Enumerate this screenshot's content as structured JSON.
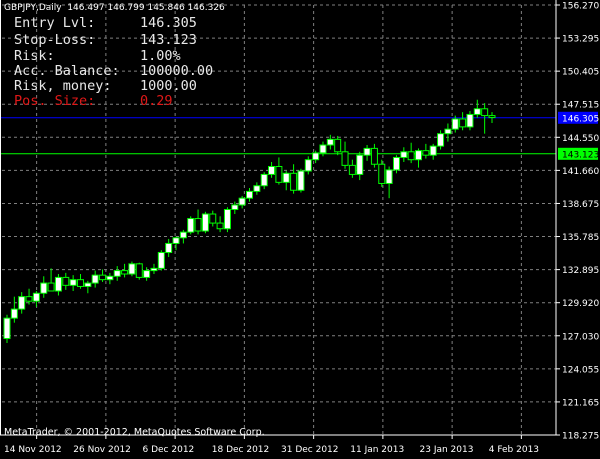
{
  "header": {
    "symbol": "GBPJPY,Daily",
    "ohlc": "146.497 146.799 145.846 146.326"
  },
  "info_panel": [
    {
      "label": "Entry Lvl:",
      "value": "146.305",
      "color": "#e8e8e8"
    },
    {
      "label": "Stop-Loss:",
      "value": "143.123",
      "color": "#e8e8e8"
    },
    {
      "label": "Risk:",
      "value": "1.00%",
      "color": "#e8e8e8"
    },
    {
      "label": "Acc. Balance:",
      "value": "100000.00",
      "color": "#e8e8e8"
    },
    {
      "label": "Risk, money:",
      "value": "1000.00",
      "color": "#e8e8e8"
    },
    {
      "label": "Pos. Size:",
      "value": "0.29",
      "color": "#e01818"
    }
  ],
  "copyright": "MetaTrader, © 2001-2012, MetaQuotes Software Corp.",
  "chart_data": {
    "type": "candlestick",
    "ylim": [
      118.275,
      156.27
    ],
    "y_ticks": [
      "156.270",
      "153.295",
      "150.405",
      "147.515",
      "144.550",
      "141.660",
      "138.675",
      "135.785",
      "132.895",
      "129.920",
      "127.030",
      "124.055",
      "121.165",
      "118.275"
    ],
    "x_ticks": [
      "14 Nov 2012",
      "26 Nov 2012",
      "6 Dec 2012",
      "18 Dec 2012",
      "31 Dec 2012",
      "11 Jan 2013",
      "23 Jan 2013",
      "4 Feb 2013"
    ],
    "levels": [
      {
        "name": "entry",
        "value": 146.305,
        "label": "146.305",
        "color": "#0000ff",
        "label_bg": "#0000ff",
        "label_color": "#ffffff"
      },
      {
        "name": "stop-loss",
        "value": 143.123,
        "label": "143.123",
        "color": "#00ff00",
        "label_bg": "#00ff00",
        "label_color": "#000000"
      }
    ],
    "colors": {
      "bull": "#ffffff",
      "bear": "#000000",
      "wick": "#00ff00",
      "grid": "#808080"
    },
    "candles": [
      [
        126.8,
        128.9,
        126.4,
        128.6
      ],
      [
        128.6,
        130.5,
        128.2,
        129.4
      ],
      [
        129.4,
        130.9,
        129.0,
        130.5
      ],
      [
        130.5,
        131.2,
        129.8,
        130.1
      ],
      [
        130.1,
        131.0,
        129.6,
        130.8
      ],
      [
        130.8,
        132.3,
        130.4,
        131.7
      ],
      [
        131.7,
        133.0,
        131.2,
        131.0
      ],
      [
        131.0,
        132.5,
        130.6,
        132.2
      ],
      [
        132.2,
        132.6,
        131.1,
        131.5
      ],
      [
        131.5,
        132.4,
        131.0,
        132.0
      ],
      [
        132.0,
        132.5,
        131.2,
        131.4
      ],
      [
        131.4,
        131.9,
        130.8,
        131.7
      ],
      [
        131.7,
        132.8,
        131.3,
        132.4
      ],
      [
        132.4,
        132.9,
        131.8,
        132.0
      ],
      [
        132.0,
        132.6,
        131.6,
        132.3
      ],
      [
        132.3,
        133.2,
        131.9,
        132.8
      ],
      [
        132.8,
        133.4,
        132.2,
        132.5
      ],
      [
        132.5,
        133.6,
        132.3,
        133.4
      ],
      [
        133.4,
        133.5,
        132.0,
        132.2
      ],
      [
        132.2,
        133.1,
        131.9,
        132.8
      ],
      [
        132.8,
        133.4,
        132.5,
        133.0
      ],
      [
        133.0,
        134.6,
        132.8,
        134.4
      ],
      [
        134.4,
        135.6,
        134.0,
        135.2
      ],
      [
        135.2,
        135.8,
        134.6,
        135.7
      ],
      [
        135.7,
        136.4,
        135.2,
        136.2
      ],
      [
        136.2,
        137.6,
        136.0,
        137.4
      ],
      [
        137.4,
        138.2,
        136.0,
        136.3
      ],
      [
        136.3,
        138.0,
        136.1,
        137.8
      ],
      [
        137.8,
        138.1,
        136.7,
        137.0
      ],
      [
        137.0,
        137.6,
        136.2,
        136.5
      ],
      [
        136.5,
        138.4,
        136.2,
        138.2
      ],
      [
        138.2,
        138.9,
        137.8,
        138.6
      ],
      [
        138.6,
        139.4,
        138.3,
        139.2
      ],
      [
        139.2,
        140.1,
        138.9,
        139.8
      ],
      [
        139.8,
        140.6,
        139.5,
        140.3
      ],
      [
        140.3,
        141.5,
        140.0,
        141.3
      ],
      [
        141.3,
        142.4,
        141.0,
        142.0
      ],
      [
        142.0,
        142.8,
        140.4,
        140.6
      ],
      [
        140.6,
        141.6,
        139.9,
        141.4
      ],
      [
        141.4,
        142.2,
        139.6,
        139.9
      ],
      [
        139.9,
        141.8,
        139.7,
        141.6
      ],
      [
        141.6,
        142.9,
        141.3,
        142.6
      ],
      [
        142.6,
        143.4,
        142.3,
        143.2
      ],
      [
        143.2,
        144.2,
        142.9,
        143.9
      ],
      [
        143.9,
        144.8,
        143.5,
        144.4
      ],
      [
        144.4,
        144.7,
        143.0,
        143.3
      ],
      [
        143.3,
        144.2,
        141.8,
        142.1
      ],
      [
        142.1,
        142.6,
        141.0,
        141.3
      ],
      [
        141.3,
        143.3,
        140.8,
        143.0
      ],
      [
        143.0,
        143.9,
        142.5,
        143.6
      ],
      [
        143.6,
        144.0,
        141.9,
        142.2
      ],
      [
        142.2,
        142.6,
        140.2,
        140.5
      ],
      [
        140.5,
        142.0,
        139.2,
        141.7
      ],
      [
        141.7,
        143.0,
        141.4,
        142.8
      ],
      [
        142.8,
        143.7,
        142.4,
        143.3
      ],
      [
        143.3,
        144.1,
        142.3,
        142.6
      ],
      [
        142.6,
        143.6,
        141.9,
        143.4
      ],
      [
        143.4,
        144.0,
        142.7,
        143.0
      ],
      [
        143.0,
        144.0,
        142.6,
        143.8
      ],
      [
        143.8,
        145.2,
        143.5,
        144.9
      ],
      [
        144.9,
        145.8,
        144.2,
        145.3
      ],
      [
        145.3,
        146.5,
        145.0,
        146.2
      ],
      [
        146.2,
        146.8,
        145.2,
        145.5
      ],
      [
        145.5,
        146.9,
        145.2,
        146.6
      ],
      [
        146.6,
        147.9,
        146.3,
        147.1
      ],
      [
        147.1,
        147.6,
        144.9,
        146.5
      ],
      [
        146.497,
        146.799,
        145.846,
        146.326
      ]
    ]
  }
}
